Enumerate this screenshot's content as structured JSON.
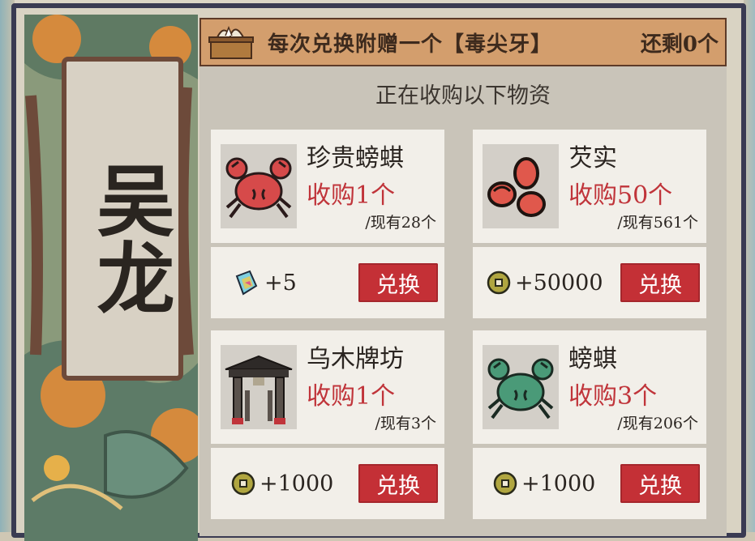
{
  "header": {
    "text": "每次兑换附赠一个【毒尖牙】",
    "remaining": "还剩0个",
    "icon": "gift-box-icon"
  },
  "side": {
    "name": "吴龙"
  },
  "main": {
    "subtitle": "正在收购以下物资"
  },
  "items": [
    {
      "name": "珍贵螃蜞",
      "buy": "收购1个",
      "have": "/现有28个",
      "icon": "red-crab-icon",
      "reward_icon": "gem-shard-icon",
      "reward": "+5",
      "button": "兑换"
    },
    {
      "name": "芡实",
      "buy": "收购50个",
      "have": "/现有561个",
      "icon": "fox-nut-icon",
      "reward_icon": "coin-icon",
      "reward": "+50000",
      "button": "兑换"
    },
    {
      "name": "乌木牌坊",
      "buy": "收购1个",
      "have": "/现有3个",
      "icon": "archway-icon",
      "reward_icon": "coin-icon",
      "reward": "+1000",
      "button": "兑换"
    },
    {
      "name": "螃蜞",
      "buy": "收购3个",
      "have": "/现有206个",
      "icon": "green-crab-icon",
      "reward_icon": "coin-icon",
      "reward": "+1000",
      "button": "兑换"
    }
  ],
  "colors": {
    "accent_red": "#c43036",
    "buy_text": "#c0343a",
    "header_bg": "#d39e6d",
    "card_bg": "#f2efe9"
  }
}
